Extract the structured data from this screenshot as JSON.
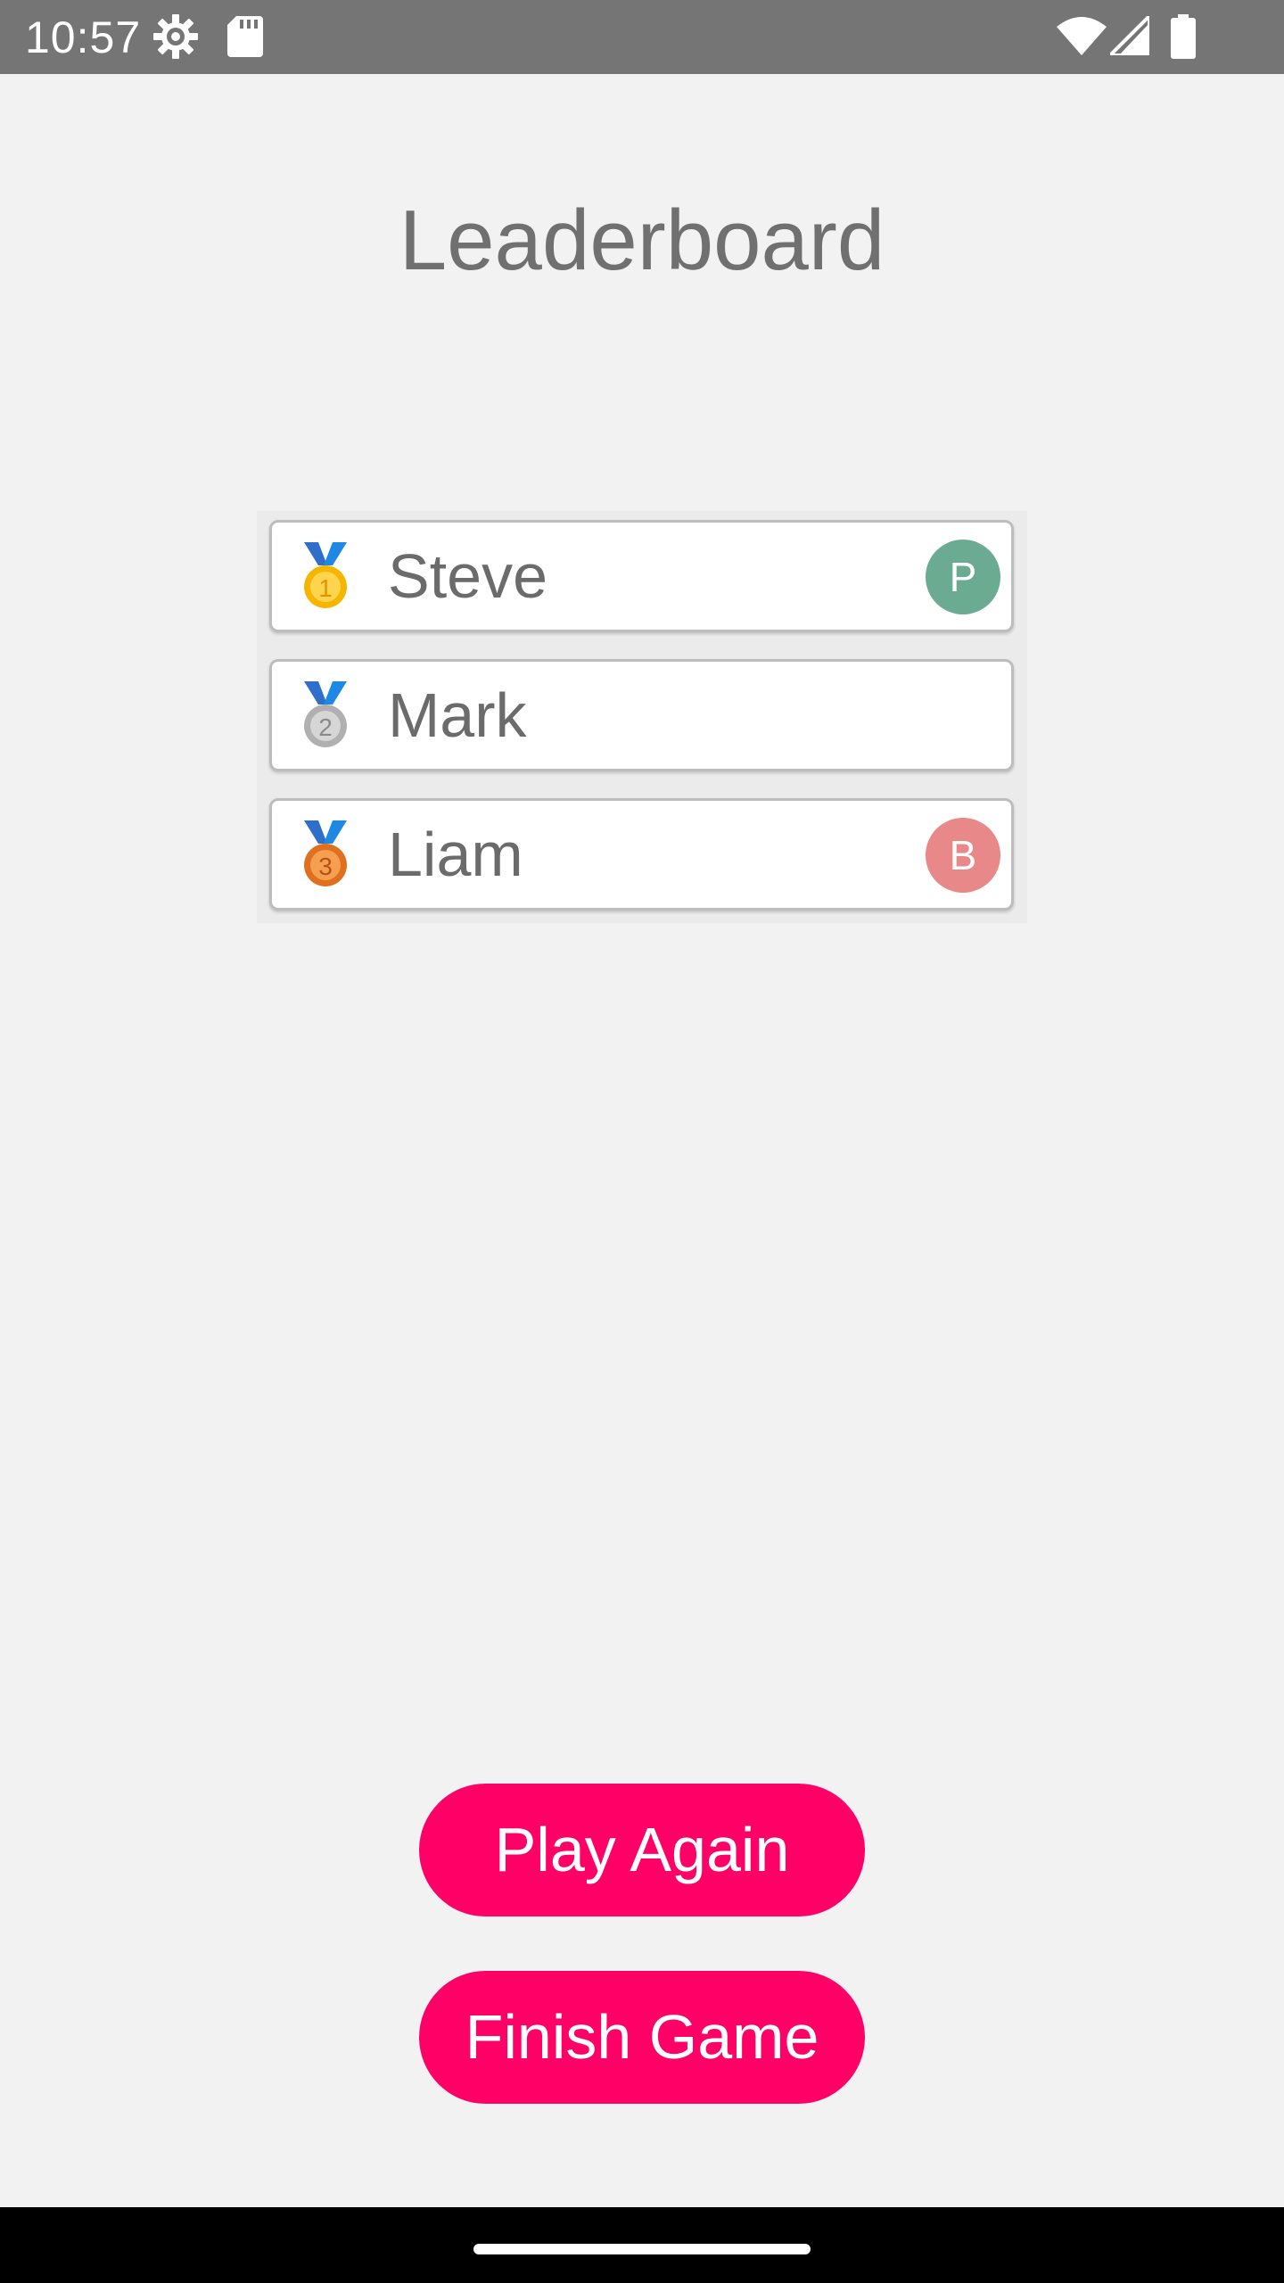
{
  "status_bar": {
    "time": "10:57",
    "icons": [
      "settings-gear-icon",
      "sd-card-icon",
      "wifi-icon",
      "cell-signal-icon",
      "battery-icon"
    ]
  },
  "title": "Leaderboard",
  "leaderboard": [
    {
      "rank": 1,
      "medal": "gold-medal-icon",
      "medal_number": "1",
      "name": "Steve",
      "badge": "P",
      "badge_color": "#6aab92"
    },
    {
      "rank": 2,
      "medal": "silver-medal-icon",
      "medal_number": "2",
      "name": "Mark",
      "badge": "",
      "badge_color": ""
    },
    {
      "rank": 3,
      "medal": "bronze-medal-icon",
      "medal_number": "3",
      "name": "Liam",
      "badge": "B",
      "badge_color": "#e88888"
    }
  ],
  "buttons": {
    "play_again": "Play Again",
    "finish_game": "Finish Game"
  },
  "colors": {
    "accent": "#ff0066",
    "status_bar": "#757575",
    "background": "#f2f2f2"
  }
}
